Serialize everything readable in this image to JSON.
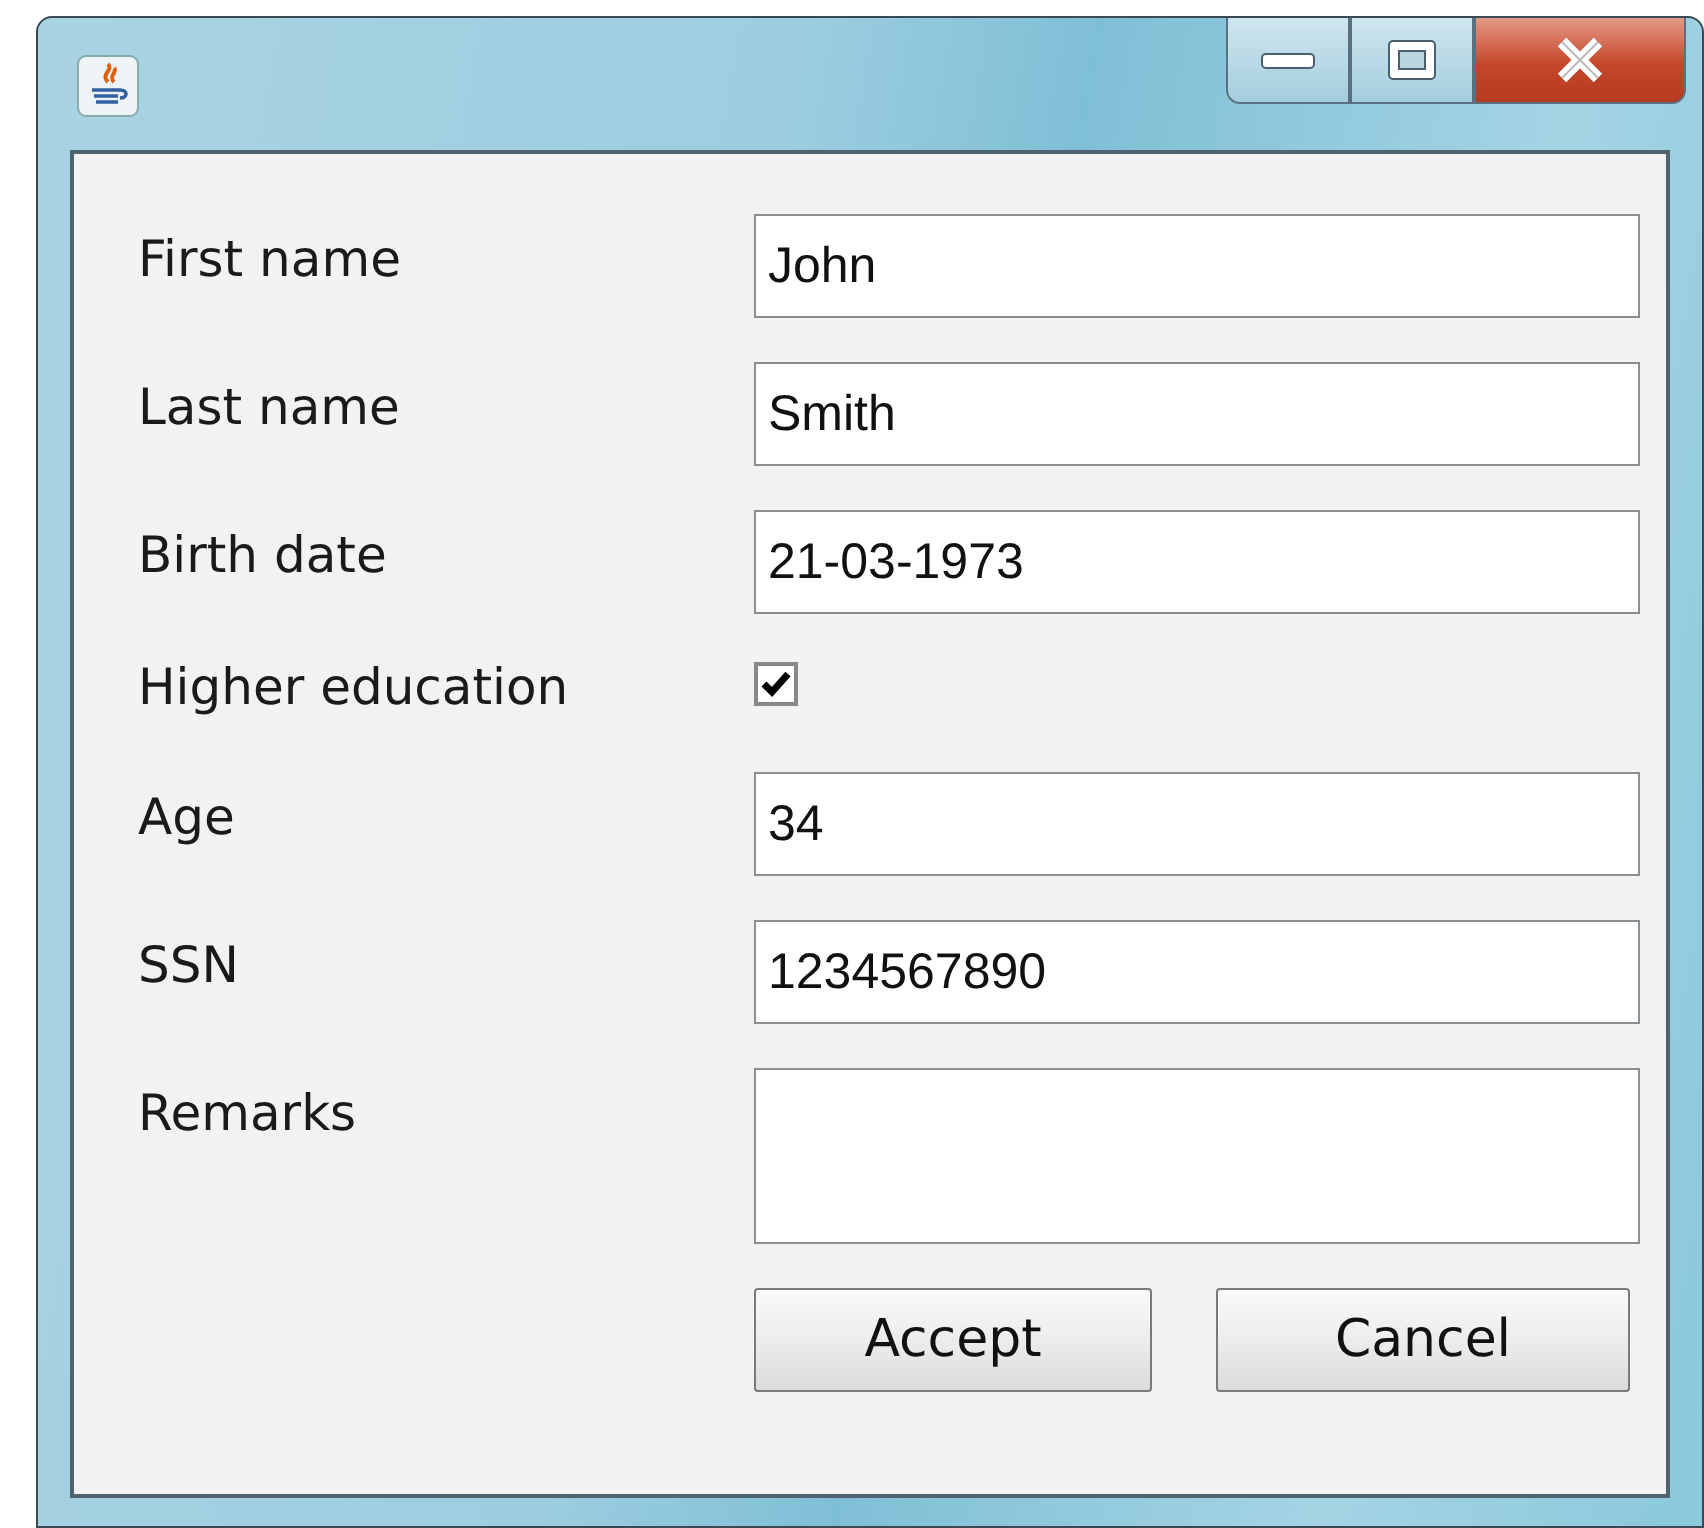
{
  "fields": [
    {
      "kind": "text",
      "label": "First name",
      "value": "John"
    },
    {
      "kind": "text",
      "label": "Last name",
      "value": "Smith"
    },
    {
      "kind": "text",
      "label": "Birth date",
      "value": "21-03-1973"
    },
    {
      "kind": "checkbox",
      "label": "Higher education",
      "checked": true
    },
    {
      "kind": "text",
      "label": "Age",
      "value": "34"
    },
    {
      "kind": "text",
      "label": "SSN",
      "value": "1234567890"
    },
    {
      "kind": "textarea",
      "label": "Remarks"
    }
  ],
  "buttons": [
    "Accept",
    "Cancel"
  ]
}
